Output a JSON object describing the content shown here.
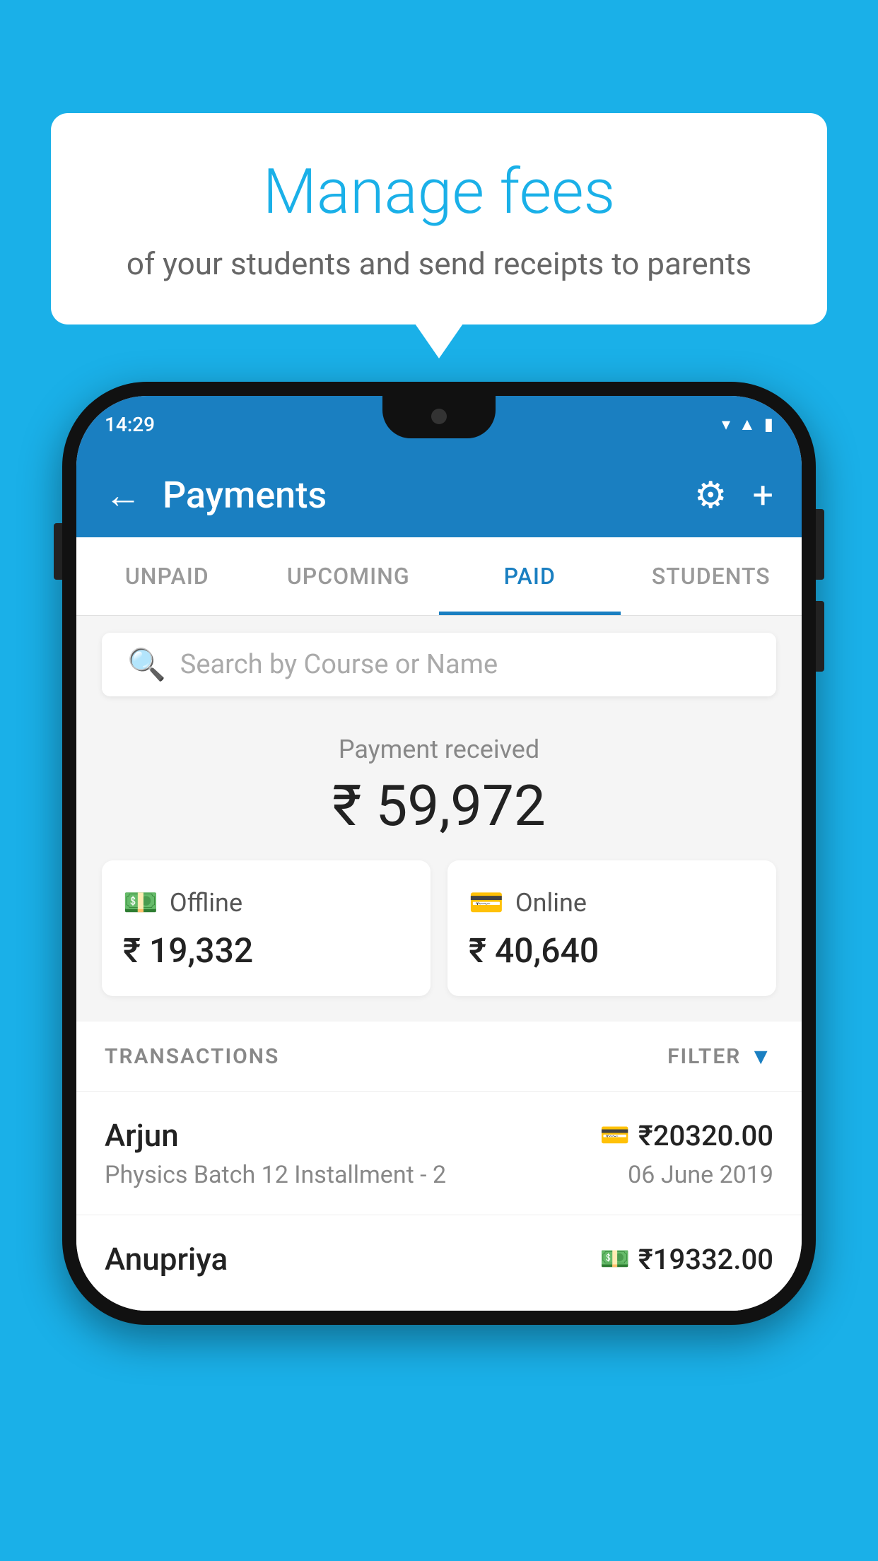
{
  "background_color": "#1ab0e8",
  "speech_bubble": {
    "title": "Manage fees",
    "subtitle": "of your students and send receipts to parents"
  },
  "status_bar": {
    "time": "14:29",
    "wifi_icon": "▼",
    "signal_icon": "▲",
    "battery_icon": "▮"
  },
  "app_bar": {
    "back_icon": "←",
    "title": "Payments",
    "settings_icon": "⚙",
    "add_icon": "+"
  },
  "tabs": [
    {
      "label": "UNPAID",
      "active": false
    },
    {
      "label": "UPCOMING",
      "active": false
    },
    {
      "label": "PAID",
      "active": true
    },
    {
      "label": "STUDENTS",
      "active": false
    }
  ],
  "search": {
    "placeholder": "Search by Course or Name"
  },
  "payment_summary": {
    "label": "Payment received",
    "amount": "₹ 59,972",
    "offline": {
      "type": "Offline",
      "amount": "₹ 19,332"
    },
    "online": {
      "type": "Online",
      "amount": "₹ 40,640"
    }
  },
  "transactions_section": {
    "label": "TRANSACTIONS",
    "filter_label": "FILTER"
  },
  "transactions": [
    {
      "name": "Arjun",
      "amount": "₹20320.00",
      "course": "Physics Batch 12 Installment - 2",
      "date": "06 June 2019",
      "type": "online"
    },
    {
      "name": "Anupriya",
      "amount": "₹19332.00",
      "course": "",
      "date": "",
      "type": "offline"
    }
  ]
}
